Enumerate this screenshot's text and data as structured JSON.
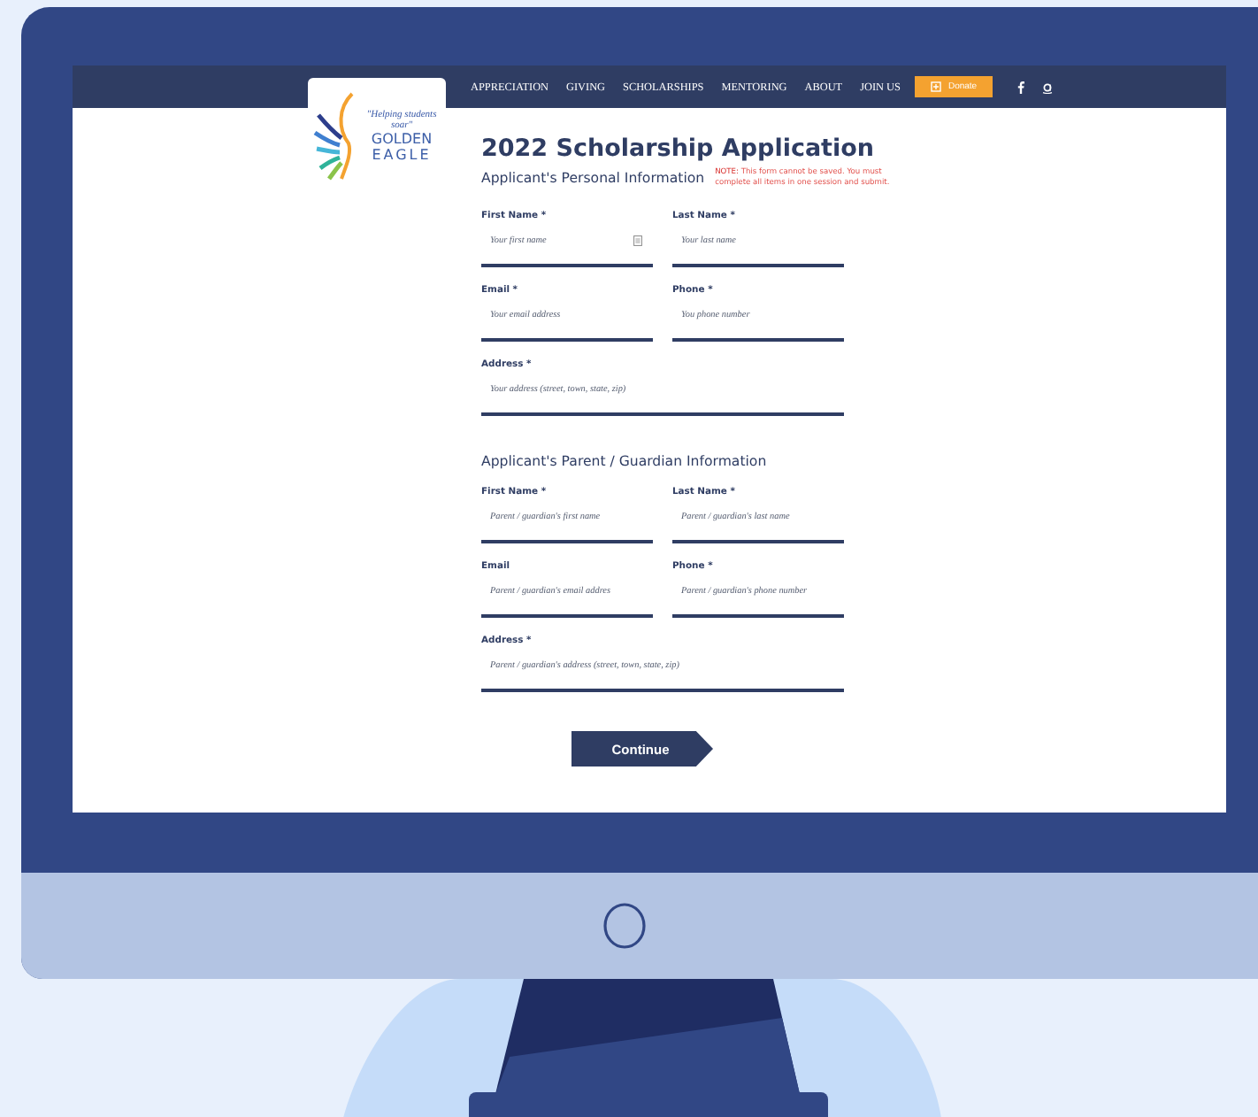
{
  "logo": {
    "tagline": "\"Helping students soar\"",
    "name_top": "GOLDEN",
    "name_bottom": "EAGLE"
  },
  "nav": {
    "items": [
      "APPRECIATION",
      "GIVING",
      "SCHOLARSHIPS",
      "MENTORING",
      "ABOUT",
      "JOIN US"
    ],
    "donate": "Donate"
  },
  "form": {
    "title": "2022 Scholarship Application",
    "note": "**NOTE:** This form cannot be saved. You must complete all items in one session and submit.",
    "sections": [
      {
        "heading": "Applicant's Personal Information",
        "fields": [
          {
            "kind": "half",
            "label": "First Name *",
            "placeholder": "Your first name",
            "contact_icon": true
          },
          {
            "kind": "half",
            "label": "Last Name *",
            "placeholder": "Your last name",
            "contact_icon": false
          },
          {
            "kind": "half",
            "label": "Email *",
            "placeholder": "Your email address",
            "contact_icon": false
          },
          {
            "kind": "half",
            "label": "Phone *",
            "placeholder": "You phone number",
            "contact_icon": false
          },
          {
            "kind": "full",
            "label": "Address *",
            "placeholder": "Your address (street, town, state, zip)",
            "contact_icon": false
          }
        ]
      },
      {
        "heading": "Applicant's Parent / Guardian Information",
        "fields": [
          {
            "kind": "half",
            "label": "First Name *",
            "placeholder": "Parent / guardian's first name",
            "contact_icon": false
          },
          {
            "kind": "half",
            "label": "Last Name *",
            "placeholder": "Parent / guardian's last name",
            "contact_icon": false
          },
          {
            "kind": "half",
            "label": "Email",
            "placeholder": "Parent / guardian's email addres",
            "contact_icon": false
          },
          {
            "kind": "half",
            "label": "Phone *",
            "placeholder": "Parent / guardian's phone number",
            "contact_icon": false
          },
          {
            "kind": "full",
            "label": "Address *",
            "placeholder": "Parent / guardian's address (street, town, state, zip)",
            "contact_icon": false
          }
        ]
      }
    ],
    "submit": "Continue"
  }
}
